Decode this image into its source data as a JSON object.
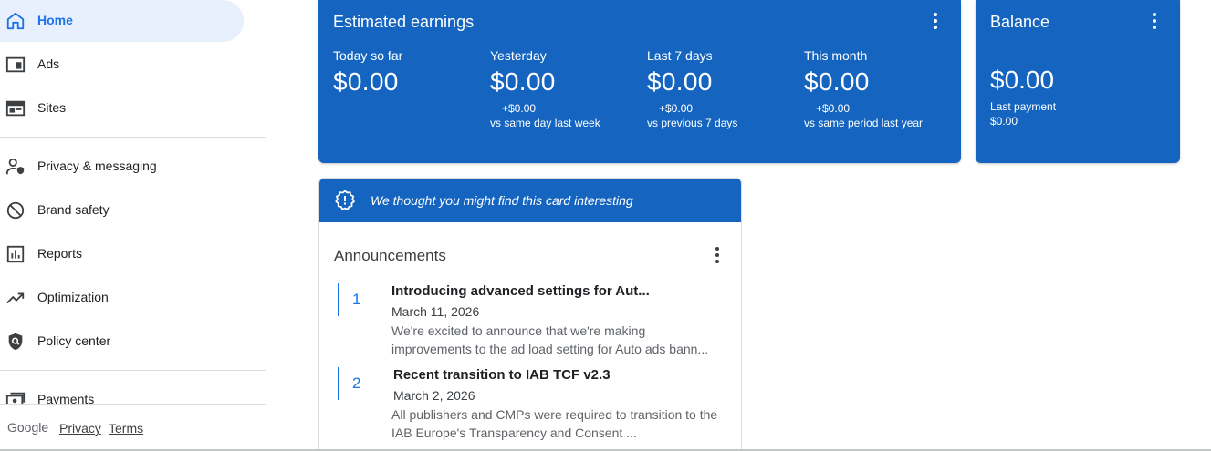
{
  "sidebar": {
    "items": [
      {
        "label": "Home",
        "icon": "home-icon"
      },
      {
        "label": "Ads",
        "icon": "ads-icon"
      },
      {
        "label": "Sites",
        "icon": "sites-icon"
      },
      {
        "label": "Privacy & messaging",
        "icon": "privacy-icon"
      },
      {
        "label": "Brand safety",
        "icon": "block-icon"
      },
      {
        "label": "Reports",
        "icon": "reports-icon"
      },
      {
        "label": "Optimization",
        "icon": "trending-up-icon"
      },
      {
        "label": "Policy center",
        "icon": "shield-icon"
      },
      {
        "label": "Payments",
        "icon": "payments-icon"
      }
    ],
    "footer": {
      "brand": "Google",
      "privacy": "Privacy",
      "terms": "Terms"
    }
  },
  "earnings": {
    "title": "Estimated earnings",
    "metrics": [
      {
        "label": "Today so far",
        "value": "$0.00",
        "delta": "",
        "compare": ""
      },
      {
        "label": "Yesterday",
        "value": "$0.00",
        "delta": "+$0.00",
        "compare": "vs same day last week"
      },
      {
        "label": "Last 7 days",
        "value": "$0.00",
        "delta": "+$0.00",
        "compare": "vs previous 7 days"
      },
      {
        "label": "This month",
        "value": "$0.00",
        "delta": "+$0.00",
        "compare": "vs same period last year"
      }
    ]
  },
  "balance": {
    "title": "Balance",
    "value": "$0.00",
    "last_payment_label": "Last payment",
    "last_payment_value": "$0.00"
  },
  "announcements": {
    "banner": "We thought you might find this card interesting",
    "title": "Announcements",
    "items": [
      {
        "num": "1",
        "title": "Introducing advanced settings for Aut...",
        "date": "March 11, 2026",
        "body": "We're excited to announce that we're making improvements to the ad load setting for Auto ads bann..."
      },
      {
        "num": "2",
        "title": "Recent transition to IAB TCF v2.3",
        "date": "March 2, 2026",
        "body": "All publishers and CMPs were required to transition to the IAB Europe's Transparency and Consent ..."
      }
    ]
  },
  "colors": {
    "accent": "#1a73e8",
    "card_blue": "#1565c0",
    "active_bg": "#e8f0fe"
  }
}
